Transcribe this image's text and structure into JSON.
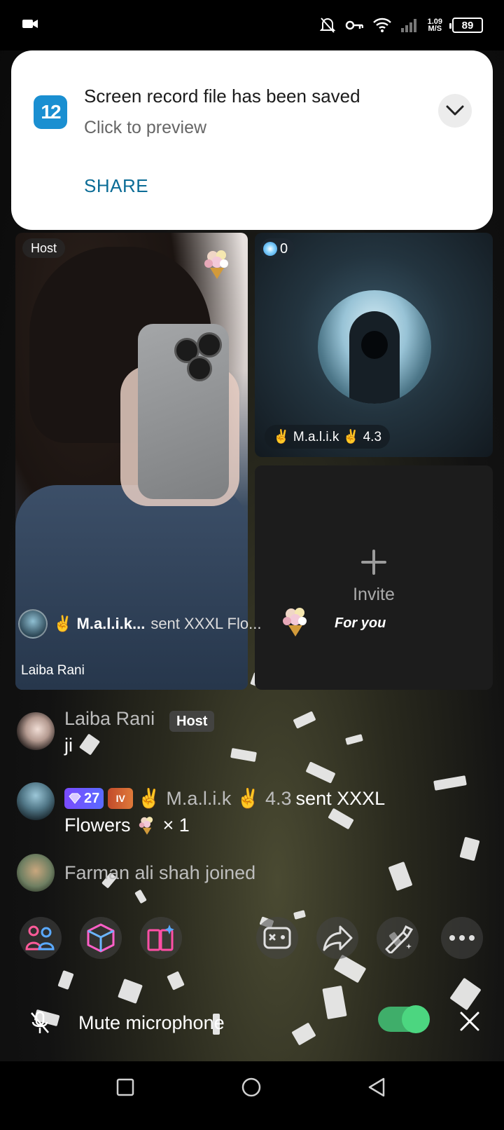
{
  "status_bar": {
    "network_speed": "1.09",
    "network_speed_unit": "M/S",
    "battery": "89",
    "icons": [
      "screen-record-icon",
      "bell-off-icon",
      "vpn-key-icon",
      "wifi-icon",
      "signal-icon",
      "battery-icon"
    ]
  },
  "notification": {
    "app_icon_text": "12",
    "title": "Screen record file has been saved",
    "subtitle": "Click to preview",
    "action": "SHARE"
  },
  "host_tile": {
    "badge": "Host",
    "name": "Laiba Rani"
  },
  "guest_tile": {
    "coins": "0",
    "name": "✌ M.a.l.i.k ✌ 4.3"
  },
  "invite_tile": {
    "label": "Invite"
  },
  "gift_banner": {
    "sender": "✌ M.a.l.i.k...",
    "text": "sent XXXL Flo...",
    "label": "For you"
  },
  "chat": [
    {
      "name": "Laiba Rani",
      "tag": "Host",
      "message": "ji"
    },
    {
      "level": "27",
      "tier": "IV",
      "name": "✌ M.a.l.i.k ✌ 4.3",
      "action": "sent XXXL",
      "gift": "Flowers",
      "count": "× 1"
    },
    {
      "text": "Farman ali shah joined"
    }
  ],
  "toolbar": [
    "people-icon",
    "cube-icon",
    "book-sparkle-icon",
    "game-controller-icon",
    "share-icon",
    "magic-wand-icon",
    "more-icon"
  ],
  "mute": {
    "label": "Mute microphone",
    "enabled": true
  },
  "colors": {
    "share_action": "#0b6c96",
    "toggle_on": "#4cd680",
    "level_badge": "#7a4bff"
  }
}
